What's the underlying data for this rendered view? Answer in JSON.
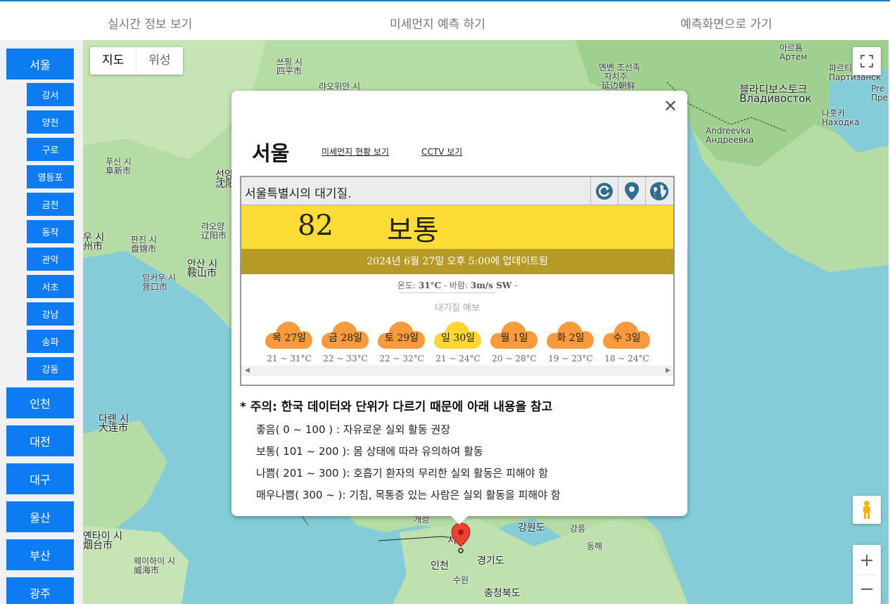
{
  "nav": {
    "realtime": "실시간 정보 보기",
    "forecast": "미세먼지 예측 하기",
    "to_forecast": "예측화면으로 가기"
  },
  "sidebar": {
    "regions": [
      "서울",
      "인천",
      "대전",
      "대구",
      "울산",
      "부산",
      "광주"
    ],
    "seoul_districts": [
      "강서",
      "양천",
      "구로",
      "영등포",
      "금천",
      "동작",
      "관악",
      "서초",
      "강남",
      "송파",
      "강동"
    ]
  },
  "map": {
    "type_map": "지도",
    "type_satellite": "위성",
    "labels": {
      "l1": "쓰핑 시",
      "l1b": "四平市",
      "l2": "랴오위안 시",
      "l3": "옌볜 조선족",
      "l3b": "자치주",
      "l3c": "延边朝鲜",
      "l4": "아르툠",
      "l4b": "Артем",
      "l5": "파르티",
      "l5b": "Партизанск",
      "l6": "블라디보스토크",
      "l6b": "Владивосток",
      "l7": "나훗카",
      "l7b": "Находка",
      "l8": "Andreevka",
      "l8b": "Андреевка",
      "l9": "푸신 시",
      "l9b": "阜新市",
      "l10": "선양",
      "l10b": "沈阳",
      "l11": "랴오양",
      "l11b": "辽阳市",
      "l12": "판진 시",
      "l12b": "盘锦市",
      "l13": "우 시",
      "l13b": "州市",
      "l14": "안산 시",
      "l14b": "鞍山市",
      "l15": "잉커우 시",
      "l15b": "营口市",
      "l16": "다롄 시",
      "l16b": "大连市",
      "l17": "옌타이 시",
      "l17b": "烟台市",
      "l18": "웨이하이 시",
      "l18b": "威海市",
      "l19": "개성",
      "l20": "서울",
      "l21": "인천",
      "l22": "수원",
      "l23": "경기도",
      "l24": "강원도",
      "l25": "강릉",
      "l26": "동해",
      "l27": "충청북도",
      "l28": "Pre",
      "l28b": "Пре"
    }
  },
  "popup": {
    "city": "서울",
    "link_dust": "미세먼지 현황 보기",
    "link_cctv": "CCTV 보기",
    "widget_title": "서울특별시의 대기질.",
    "aqi": "82",
    "level": "보통",
    "updated": "2024년 6월 27일 오후 5:00에 업데이트됨",
    "weather_prefix": "온도: ",
    "temp": "31°C",
    "wind_prefix": " - 바람: ",
    "wind": "3m/s SW",
    "weather_suffix": " -",
    "forecast_title": "대기질 예보",
    "forecast": [
      {
        "day": "목 27일",
        "range": "21 ~ 31°C",
        "color": "#f99a3c"
      },
      {
        "day": "금 28일",
        "range": "22 ~ 33°C",
        "color": "#f99a3c"
      },
      {
        "day": "토 29일",
        "range": "22 ~ 32°C",
        "color": "#f99a3c"
      },
      {
        "day": "일 30일",
        "range": "21 ~ 24°C",
        "color": "#fdd535"
      },
      {
        "day": "월 1일",
        "range": "20 ~ 28°C",
        "color": "#f99a3c"
      },
      {
        "day": "화 2일",
        "range": "19 ~ 23°C",
        "color": "#f99a3c"
      },
      {
        "day": "수 3일",
        "range": "18 ~ 24°C",
        "color": "#f99a3c"
      }
    ],
    "note_title": "* 주의: 한국 데이터와 단위가 다르기 때문에 아래 내용을 참고",
    "notes": [
      "좋음( 0 ~ 100 ) : 자유로운 실외 활동 권장",
      "보통( 101 ~ 200 ): 몸 상태에 따라 유의하여 활동",
      "나쁨( 201 ~ 300 ): 호흡기 환자의 무리한 실외 활동은 피해야 함",
      "매우나쁨( 300 ~ ): 기침, 목통증 있는 사람은 실외 활동을 피해야 함"
    ]
  },
  "colors": {
    "accent": "#0d7cf2",
    "aqi_moderate": "#fddd35",
    "update_bar": "#b59a26"
  }
}
